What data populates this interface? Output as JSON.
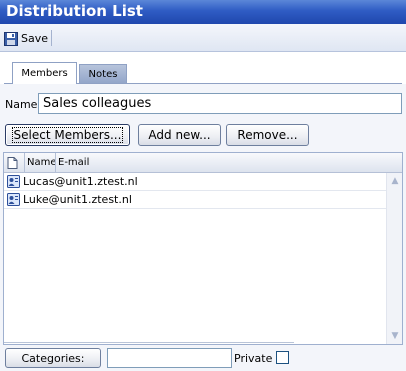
{
  "window": {
    "title": "Distribution List"
  },
  "toolbar": {
    "save_label": "Save",
    "save_icon": "floppy-disk-icon"
  },
  "tabs": [
    {
      "label": "Members",
      "active": true
    },
    {
      "label": "Notes",
      "active": false
    }
  ],
  "form": {
    "name_label": "Name:",
    "name_value": "Sales colleagues"
  },
  "buttons": {
    "select_members": "Select Members...",
    "add_new": "Add new...",
    "remove": "Remove..."
  },
  "list": {
    "columns": [
      "Name",
      "E-mail"
    ],
    "rows": [
      {
        "text": "Lucas@unit1.ztest.nl",
        "icon": "contact-card-icon"
      },
      {
        "text": "Luke@unit1.ztest.nl",
        "icon": "contact-card-icon"
      }
    ]
  },
  "footer": {
    "categories_label": "Categories:",
    "categories_value": "",
    "private_label": "Private",
    "private_checked": false
  },
  "colors": {
    "title_bar": "#2f5cc4",
    "accent_border": "#8fa1c4"
  }
}
